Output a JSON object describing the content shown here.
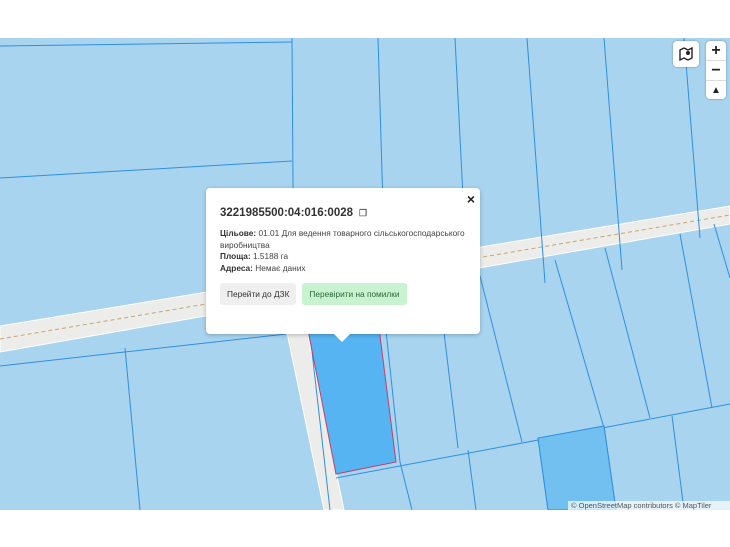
{
  "map": {
    "parcel_fill": "#56b4f2",
    "parcel_fill_alt": "#72c0f0",
    "background": "#a9d4ef",
    "road_color": "#ececea",
    "parcel_border": "#c0406a"
  },
  "controls": {
    "layers_icon": "map-layers-icon",
    "zoom_in": "+",
    "zoom_out": "−",
    "compass": "▲"
  },
  "popup": {
    "cadastral_number": "3221985500:04:016:0028",
    "purpose_label": "Цільове:",
    "purpose_value": "01.01 Для ведення товарного сільськогосподарського виробництва",
    "area_label": "Площа:",
    "area_value": "1.5188 га",
    "address_label": "Адреса:",
    "address_value": "Немає даних",
    "close": "×",
    "button_dzk": "Перейти до ДЗК",
    "button_check": "Перевірити на помилки"
  },
  "attribution": "© OpenStreetMap contributors © MapTiler"
}
